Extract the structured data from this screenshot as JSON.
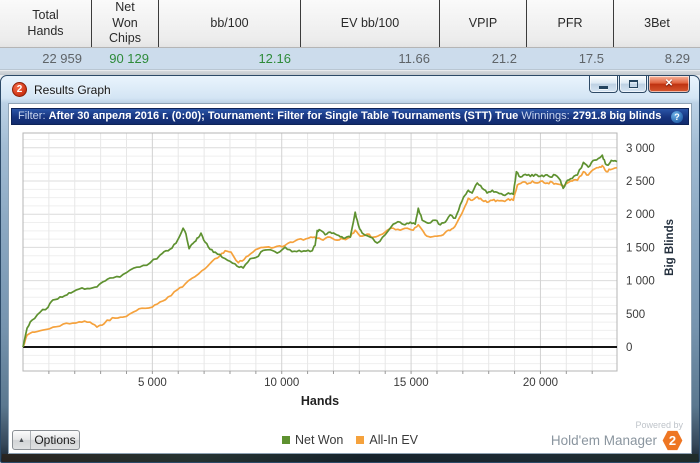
{
  "stats_table": {
    "columns": [
      {
        "header": "Total Hands",
        "value": "22 959",
        "value_color": "#5f6468"
      },
      {
        "header": "Net Won Chips",
        "value": "90 129",
        "value_color": "#2e8b3a"
      },
      {
        "header": "bb/100",
        "value": "12.16",
        "value_color": "#2e8b3a"
      },
      {
        "header": "EV bb/100",
        "value": "11.66",
        "value_color": "#5f6468"
      },
      {
        "header": "VPIP",
        "value": "21.2",
        "value_color": "#5f6468"
      },
      {
        "header": "PFR",
        "value": "17.5",
        "value_color": "#5f6468"
      },
      {
        "header": "3Bet",
        "value": "8.29",
        "value_color": "#5f6468"
      }
    ]
  },
  "window": {
    "title": "Results Graph",
    "title_badge": "2",
    "filter": {
      "label": "Filter:",
      "text": "After 30 апреля 2016 г. (0:00); Tournament: Filter for Single Table Tournaments (STT) True",
      "winnings_label": "Winnings:",
      "winnings_value": "2791.8 big blinds"
    },
    "options_label": "Options",
    "powered_by": "Powered by",
    "brand": "Hold'em Manager",
    "brand_badge": "2"
  },
  "icons": {
    "close_glyph": "✕",
    "up_arrow": "▲",
    "help": "?"
  },
  "chart_data": {
    "type": "line",
    "xlabel": "Hands",
    "ylabel": "Big Blinds",
    "xlim": [
      0,
      22959
    ],
    "ylim": [
      -361,
      3223
    ],
    "grid": true,
    "legend_position": "bottom-center",
    "x_ticks": [
      {
        "value": 5000,
        "label": "5 000"
      },
      {
        "value": 10000,
        "label": "10 000"
      },
      {
        "value": 15000,
        "label": "15 000"
      },
      {
        "value": 20000,
        "label": "20 000"
      }
    ],
    "y_ticks": [
      {
        "value": 0,
        "label": "0"
      },
      {
        "value": 500,
        "label": "500"
      },
      {
        "value": 1000,
        "label": "1 000"
      },
      {
        "value": 1500,
        "label": "1 500"
      },
      {
        "value": 2000,
        "label": "2 000"
      },
      {
        "value": 2500,
        "label": "2 500"
      },
      {
        "value": 3000,
        "label": "3 000"
      }
    ],
    "legend": [
      {
        "name": "Net Won",
        "color": "#5e9130"
      },
      {
        "name": "All-In EV",
        "color": "#f5a23d"
      }
    ],
    "series": [
      {
        "name": "Net Won",
        "color": "#5e9130",
        "points": [
          [
            0,
            0
          ],
          [
            160,
            285
          ],
          [
            350,
            405
          ],
          [
            660,
            525
          ],
          [
            970,
            600
          ],
          [
            1160,
            710
          ],
          [
            1430,
            755
          ],
          [
            1700,
            785
          ],
          [
            1930,
            830
          ],
          [
            2280,
            890
          ],
          [
            2590,
            880
          ],
          [
            2860,
            905
          ],
          [
            3090,
            980
          ],
          [
            3360,
            1040
          ],
          [
            3750,
            1055
          ],
          [
            4140,
            1160
          ],
          [
            4520,
            1205
          ],
          [
            4910,
            1265
          ],
          [
            5300,
            1385
          ],
          [
            5530,
            1450
          ],
          [
            5760,
            1490
          ],
          [
            5990,
            1620
          ],
          [
            6190,
            1790
          ],
          [
            6300,
            1700
          ],
          [
            6420,
            1480
          ],
          [
            6570,
            1560
          ],
          [
            6730,
            1640
          ],
          [
            6880,
            1715
          ],
          [
            7040,
            1580
          ],
          [
            7230,
            1470
          ],
          [
            7430,
            1430
          ],
          [
            7700,
            1350
          ],
          [
            8010,
            1290
          ],
          [
            8280,
            1215
          ],
          [
            8510,
            1190
          ],
          [
            8780,
            1330
          ],
          [
            9010,
            1350
          ],
          [
            9280,
            1455
          ],
          [
            9550,
            1465
          ],
          [
            9820,
            1415
          ],
          [
            10130,
            1505
          ],
          [
            10400,
            1435
          ],
          [
            10670,
            1455
          ],
          [
            10940,
            1445
          ],
          [
            11180,
            1450
          ],
          [
            11290,
            1530
          ],
          [
            11370,
            1755
          ],
          [
            11490,
            1760
          ],
          [
            11680,
            1690
          ],
          [
            11870,
            1730
          ],
          [
            12070,
            1700
          ],
          [
            12260,
            1660
          ],
          [
            12450,
            1640
          ],
          [
            12650,
            1655
          ],
          [
            12840,
            2030
          ],
          [
            12960,
            1840
          ],
          [
            13110,
            1715
          ],
          [
            13420,
            1655
          ],
          [
            13690,
            1565
          ],
          [
            14000,
            1690
          ],
          [
            14310,
            1850
          ],
          [
            14580,
            1880
          ],
          [
            14770,
            1840
          ],
          [
            14970,
            1880
          ],
          [
            15160,
            1850
          ],
          [
            15280,
            2090
          ],
          [
            15430,
            1910
          ],
          [
            15660,
            1865
          ],
          [
            15930,
            1910
          ],
          [
            16130,
            1840
          ],
          [
            16320,
            1880
          ],
          [
            16510,
            1990
          ],
          [
            16710,
            1940
          ],
          [
            16900,
            2140
          ],
          [
            17090,
            2290
          ],
          [
            17210,
            2360
          ],
          [
            17360,
            2320
          ],
          [
            17560,
            2470
          ],
          [
            17750,
            2390
          ],
          [
            17940,
            2320
          ],
          [
            18140,
            2360
          ],
          [
            18330,
            2330
          ],
          [
            18560,
            2290
          ],
          [
            18760,
            2320
          ],
          [
            18950,
            2300
          ],
          [
            19070,
            2640
          ],
          [
            19220,
            2560
          ],
          [
            19410,
            2600
          ],
          [
            19610,
            2570
          ],
          [
            19800,
            2600
          ],
          [
            19990,
            2570
          ],
          [
            20190,
            2590
          ],
          [
            20380,
            2560
          ],
          [
            20570,
            2590
          ],
          [
            20770,
            2510
          ],
          [
            20880,
            2390
          ],
          [
            21040,
            2510
          ],
          [
            21230,
            2540
          ],
          [
            21430,
            2590
          ],
          [
            21660,
            2780
          ],
          [
            21850,
            2710
          ],
          [
            22040,
            2810
          ],
          [
            22240,
            2840
          ],
          [
            22390,
            2890
          ],
          [
            22510,
            2760
          ],
          [
            22620,
            2740
          ],
          [
            22740,
            2810
          ],
          [
            22959,
            2792
          ]
        ]
      },
      {
        "name": "All-In EV",
        "color": "#f5a23d",
        "points": [
          [
            0,
            0
          ],
          [
            160,
            180
          ],
          [
            460,
            225
          ],
          [
            770,
            255
          ],
          [
            1160,
            300
          ],
          [
            1550,
            345
          ],
          [
            1930,
            360
          ],
          [
            2280,
            375
          ],
          [
            2590,
            375
          ],
          [
            2860,
            300
          ],
          [
            3060,
            330
          ],
          [
            3250,
            405
          ],
          [
            3560,
            435
          ],
          [
            3870,
            450
          ],
          [
            4250,
            525
          ],
          [
            4600,
            585
          ],
          [
            4990,
            600
          ],
          [
            5300,
            680
          ],
          [
            5610,
            755
          ],
          [
            5960,
            860
          ],
          [
            6270,
            950
          ],
          [
            6650,
            1060
          ],
          [
            7040,
            1180
          ],
          [
            7310,
            1290
          ],
          [
            7620,
            1375
          ],
          [
            7810,
            1450
          ],
          [
            8040,
            1430
          ],
          [
            8320,
            1270
          ],
          [
            8550,
            1320
          ],
          [
            8780,
            1400
          ],
          [
            9090,
            1480
          ],
          [
            9400,
            1505
          ],
          [
            9710,
            1500
          ],
          [
            10020,
            1510
          ],
          [
            10330,
            1580
          ],
          [
            10630,
            1620
          ],
          [
            10940,
            1630
          ],
          [
            11210,
            1650
          ],
          [
            11370,
            1640
          ],
          [
            11600,
            1610
          ],
          [
            11870,
            1655
          ],
          [
            12140,
            1610
          ],
          [
            12380,
            1625
          ],
          [
            12650,
            1655
          ],
          [
            12840,
            1760
          ],
          [
            13030,
            1670
          ],
          [
            13300,
            1700
          ],
          [
            13540,
            1655
          ],
          [
            13810,
            1690
          ],
          [
            14080,
            1760
          ],
          [
            14310,
            1790
          ],
          [
            14580,
            1760
          ],
          [
            14850,
            1790
          ],
          [
            15080,
            1760
          ],
          [
            15280,
            1840
          ],
          [
            15550,
            1690
          ],
          [
            15740,
            1655
          ],
          [
            16010,
            1670
          ],
          [
            16240,
            1690
          ],
          [
            16440,
            1760
          ],
          [
            16630,
            1790
          ],
          [
            16820,
            1910
          ],
          [
            17020,
            2060
          ],
          [
            17210,
            2240
          ],
          [
            17360,
            2210
          ],
          [
            17560,
            2260
          ],
          [
            17750,
            2210
          ],
          [
            17940,
            2180
          ],
          [
            18140,
            2210
          ],
          [
            18330,
            2210
          ],
          [
            18560,
            2200
          ],
          [
            18760,
            2230
          ],
          [
            18950,
            2210
          ],
          [
            19110,
            2440
          ],
          [
            19300,
            2480
          ],
          [
            19490,
            2455
          ],
          [
            19690,
            2500
          ],
          [
            19880,
            2470
          ],
          [
            20070,
            2500
          ],
          [
            20260,
            2470
          ],
          [
            20460,
            2480
          ],
          [
            20650,
            2455
          ],
          [
            20840,
            2425
          ],
          [
            21040,
            2470
          ],
          [
            21230,
            2500
          ],
          [
            21430,
            2510
          ],
          [
            21660,
            2640
          ],
          [
            21850,
            2590
          ],
          [
            22040,
            2670
          ],
          [
            22240,
            2700
          ],
          [
            22390,
            2730
          ],
          [
            22550,
            2640
          ],
          [
            22700,
            2670
          ],
          [
            22959,
            2700
          ]
        ]
      }
    ]
  }
}
